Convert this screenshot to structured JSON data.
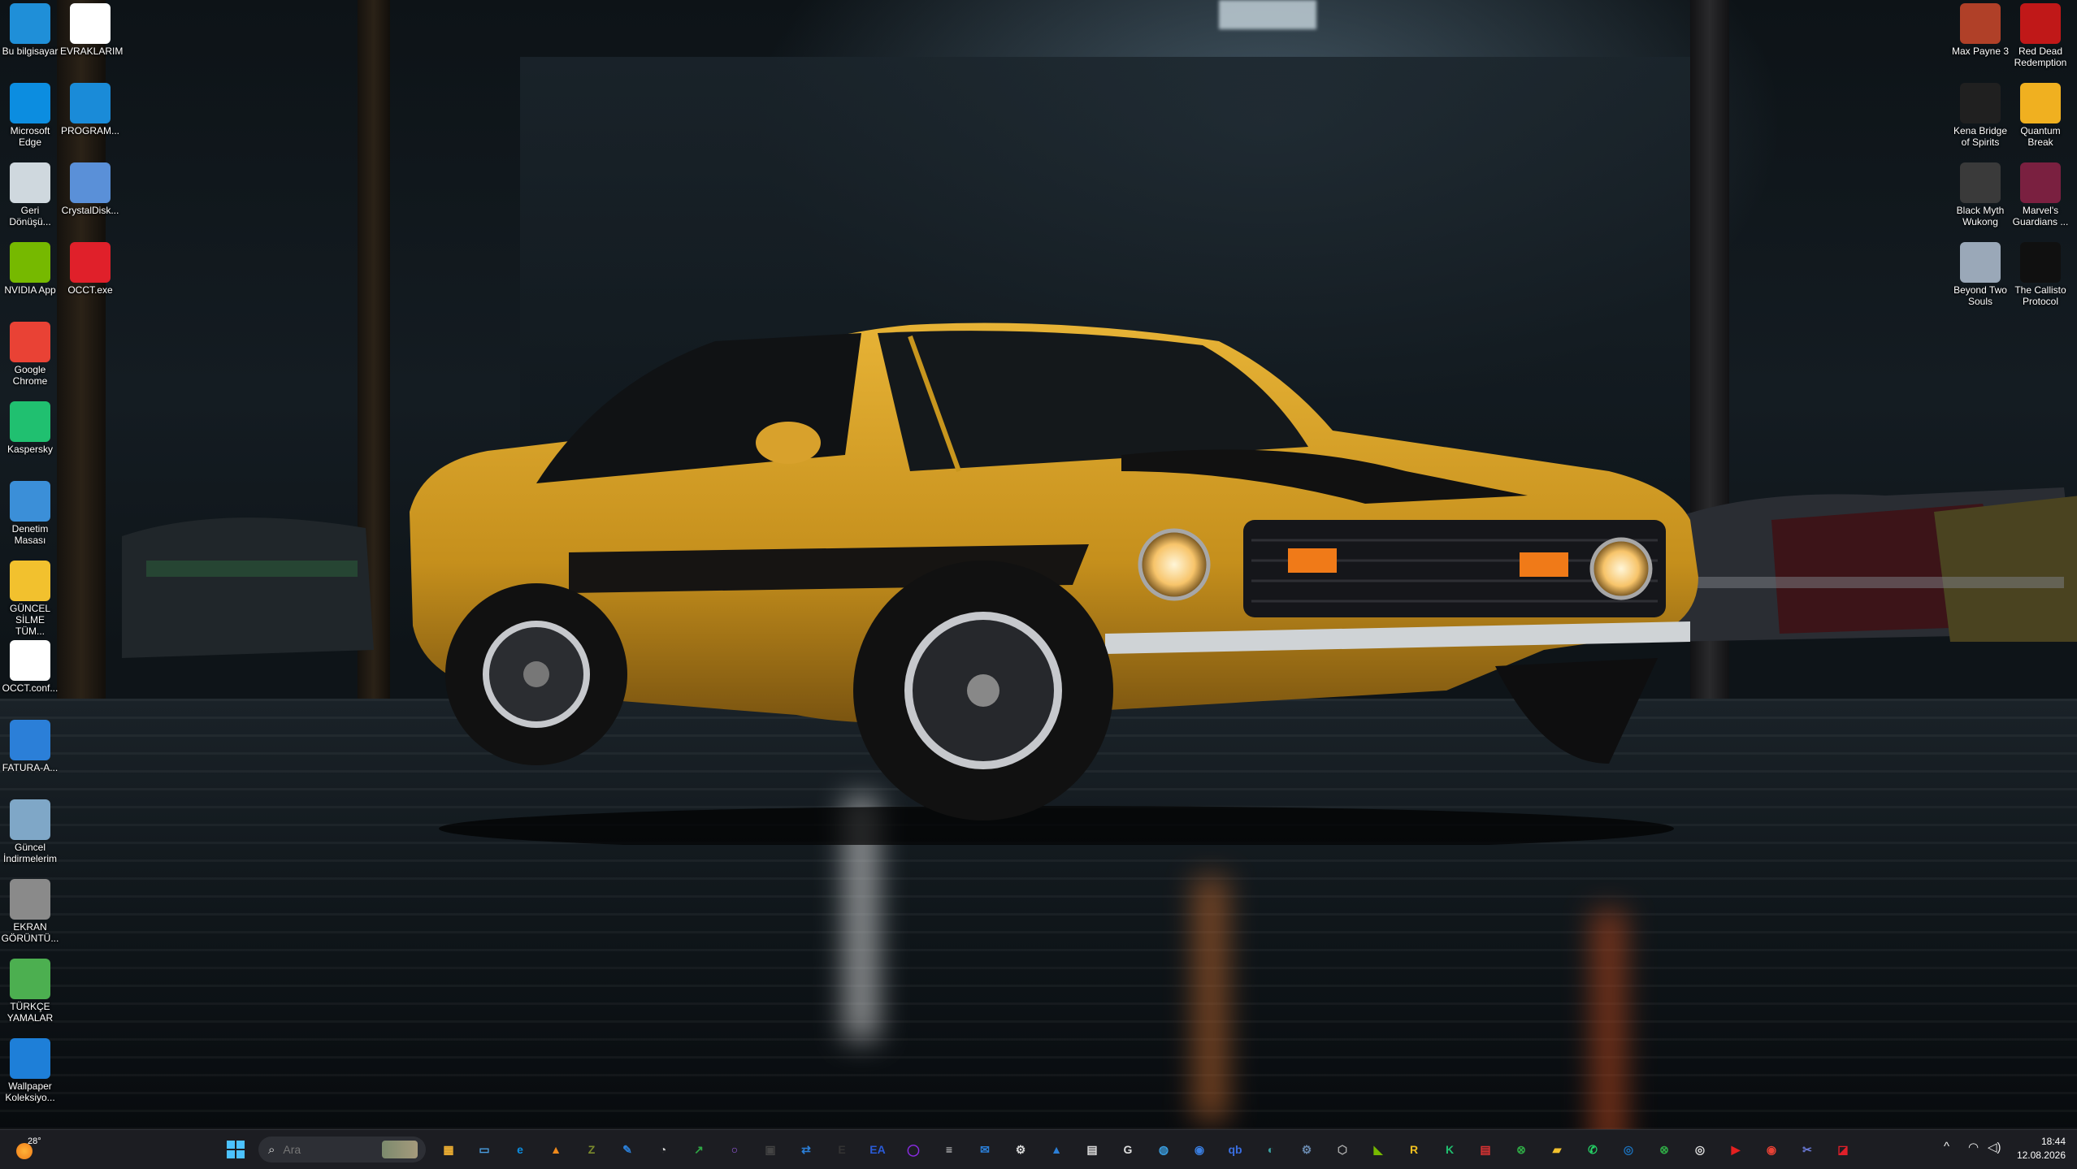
{
  "desktop": {
    "left_icons": [
      {
        "label": "Bu bilgisayar",
        "icon": "monitor-icon",
        "color": "#1f8fd8"
      },
      {
        "label": "EVRAKLARIM",
        "icon": "folder-outline-icon",
        "color": "#ffffff"
      },
      {
        "label": "Microsoft Edge",
        "icon": "edge-icon",
        "color": "#0c8de0"
      },
      {
        "label": "PROGRAM...",
        "icon": "program-icon",
        "color": "#1a8bd8"
      },
      {
        "label": "Geri Dönüşü...",
        "icon": "recycle-bin-icon",
        "color": "#cfd8de"
      },
      {
        "label": "CrystalDisk...",
        "icon": "crystaldisk-icon",
        "color": "#5a90d8"
      },
      {
        "label": "NVIDIA App",
        "icon": "nvidia-icon",
        "color": "#76b900"
      },
      {
        "label": "OCCT.exe",
        "icon": "occt-icon",
        "color": "#e0202a"
      },
      {
        "label": "Google Chrome",
        "icon": "chrome-icon",
        "color": "#e94235"
      },
      {
        "label": "Kaspersky",
        "icon": "kaspersky-icon",
        "color": "#20c070"
      },
      {
        "label": "Denetim Masası",
        "icon": "control-panel-icon",
        "color": "#3b8fd8"
      },
      {
        "label": "GÜNCEL SİLME TÜM...",
        "icon": "folder-icon",
        "color": "#f2c12e"
      },
      {
        "label": "OCCT.conf...",
        "icon": "file-icon",
        "color": "#ffffff"
      },
      {
        "label": "FATURA-A...",
        "icon": "app-window-icon",
        "color": "#2b7fd8"
      },
      {
        "label": "Güncel İndirmelerim",
        "icon": "search-folder-icon",
        "color": "#7fa7c7"
      },
      {
        "label": "EKRAN GÖRÜNTÜ...",
        "icon": "zip-icon",
        "color": "#8a8a8a"
      },
      {
        "label": "TÜRKÇE YAMALAR",
        "icon": "tree-icon",
        "color": "#4caf50"
      },
      {
        "label": "Wallpaper Koleksiyo...",
        "icon": "accessibility-icon",
        "color": "#1e7fd8"
      }
    ],
    "right_icons": [
      {
        "label": "Max Payne 3",
        "icon": "max-payne-icon",
        "color": "#b04028"
      },
      {
        "label": "Red Dead Redemption",
        "icon": "rdr-icon",
        "color": "#c01818"
      },
      {
        "label": "Kena Bridge of Spirits",
        "icon": "kena-icon",
        "color": "#202020"
      },
      {
        "label": "Quantum Break",
        "icon": "quantum-break-icon",
        "color": "#f0b020"
      },
      {
        "label": "Black Myth Wukong",
        "icon": "wukong-icon",
        "color": "#3a3a3a"
      },
      {
        "label": "Marvel's Guardians ...",
        "icon": "guardians-icon",
        "color": "#7a2040"
      },
      {
        "label": "Beyond Two Souls",
        "icon": "beyond-icon",
        "color": "#9aa8b8"
      },
      {
        "label": "The Callisto Protocol",
        "icon": "callisto-icon",
        "color": "#101010"
      }
    ]
  },
  "taskbar": {
    "weather_temp": "28°",
    "search_placeholder": "Ara",
    "apps": [
      {
        "name": "widget-icon",
        "glyph": "▦",
        "color": "#f2b233"
      },
      {
        "name": "explorer-window-icon",
        "glyph": "▭",
        "color": "#4a9ee0"
      },
      {
        "name": "edge-icon",
        "glyph": "e",
        "color": "#0c8de0"
      },
      {
        "name": "vlc-icon",
        "glyph": "▲",
        "color": "#f08a1c"
      },
      {
        "name": "cpuz-icon",
        "glyph": "Z",
        "color": "#7a8a2c"
      },
      {
        "name": "notepad-icon",
        "glyph": "✎",
        "color": "#2b7fd8"
      },
      {
        "name": "speed-icon",
        "glyph": "◔",
        "color": "#cccccc"
      },
      {
        "name": "green-app-icon",
        "glyph": "↗",
        "color": "#2fa845"
      },
      {
        "name": "circle-app-icon",
        "glyph": "○",
        "color": "#9b5de5"
      },
      {
        "name": "media-icon",
        "glyph": "▣",
        "color": "#444444"
      },
      {
        "name": "share-icon",
        "glyph": "⇄",
        "color": "#2b7fd8"
      },
      {
        "name": "epic-icon",
        "glyph": "E",
        "color": "#333333"
      },
      {
        "name": "ea-icon",
        "glyph": "EA",
        "color": "#2a5bd7"
      },
      {
        "name": "ring-icon",
        "glyph": "◯",
        "color": "#8a2be2"
      },
      {
        "name": "stack-icon",
        "glyph": "≡",
        "color": "#dddddd"
      },
      {
        "name": "mail-icon",
        "glyph": "✉",
        "color": "#2b7fd8"
      },
      {
        "name": "gear-icon",
        "glyph": "⚙",
        "color": "#dddddd"
      },
      {
        "name": "photos-icon",
        "glyph": "▲",
        "color": "#2b7fd8"
      },
      {
        "name": "calculator-icon",
        "glyph": "▤",
        "color": "#dddddd"
      },
      {
        "name": "logitech-icon",
        "glyph": "G",
        "color": "#dddddd"
      },
      {
        "name": "globe-icon",
        "glyph": "◍",
        "color": "#3a9ee0"
      },
      {
        "name": "browser-icon",
        "glyph": "◉",
        "color": "#3a7ee0"
      },
      {
        "name": "qbittorrent-icon",
        "glyph": "qb",
        "color": "#3a6ee0"
      },
      {
        "name": "network-icon",
        "glyph": "◐",
        "color": "#3aa0a0"
      },
      {
        "name": "settings-icon",
        "glyph": "⚙",
        "color": "#6a8ab0"
      },
      {
        "name": "cube-icon",
        "glyph": "⬡",
        "color": "#aaaaaa"
      },
      {
        "name": "nvidia-icon",
        "glyph": "◣",
        "color": "#76b900"
      },
      {
        "name": "r-app-icon",
        "glyph": "R",
        "color": "#f0c020"
      },
      {
        "name": "kaspersky-icon",
        "glyph": "K",
        "color": "#20c070"
      },
      {
        "name": "document-icon",
        "glyph": "▤",
        "color": "#dd3333"
      },
      {
        "name": "xbox-game-icon",
        "glyph": "⊗",
        "color": "#2fa845"
      },
      {
        "name": "folder-icon",
        "glyph": "▰",
        "color": "#f2c12e"
      },
      {
        "name": "whatsapp-icon",
        "glyph": "✆",
        "color": "#25d366"
      },
      {
        "name": "steam-icon",
        "glyph": "◎",
        "color": "#1b6fb8"
      },
      {
        "name": "xbox-icon",
        "glyph": "⊗",
        "color": "#2fa845"
      },
      {
        "name": "circle-target-icon",
        "glyph": "◎",
        "color": "#dddddd"
      },
      {
        "name": "youtube-music-icon",
        "glyph": "▶",
        "color": "#e52020"
      },
      {
        "name": "chrome-icon",
        "glyph": "◉",
        "color": "#e94235"
      },
      {
        "name": "screenshot-icon",
        "glyph": "✂",
        "color": "#6a7ad8"
      },
      {
        "name": "occt-icon",
        "glyph": "◪",
        "color": "#e0202a"
      }
    ],
    "clock_time": "18:44",
    "clock_date": "12.08.2026"
  }
}
